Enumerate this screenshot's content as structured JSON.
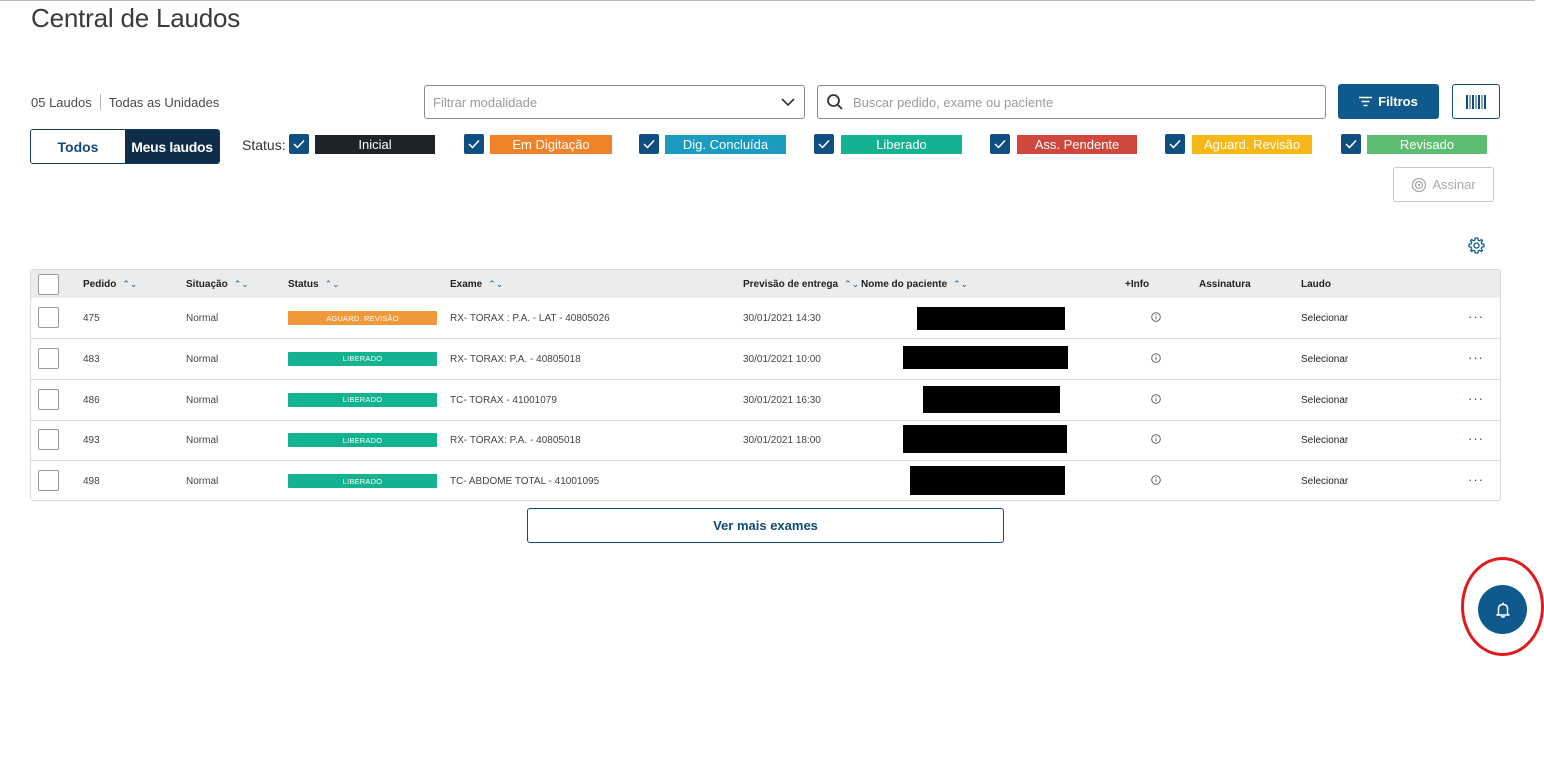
{
  "page": {
    "title": "Central de Laudos"
  },
  "summary": {
    "count": "05 Laudos",
    "unit": "Todas as Unidades"
  },
  "filters": {
    "modality_placeholder": "Filtrar modalidade",
    "search_placeholder": "Buscar pedido, exame ou paciente",
    "filtros_label": "Filtros"
  },
  "toggle": {
    "todos": "Todos",
    "meus": "Meus laudos"
  },
  "status_filter": {
    "label": "Status:",
    "items": [
      {
        "label": "Inicial",
        "color": "#1f2428"
      },
      {
        "label": "Em Digitação",
        "color": "#f0832a"
      },
      {
        "label": "Dig. Concluída",
        "color": "#1b9bc2"
      },
      {
        "label": "Liberado",
        "color": "#13b290"
      },
      {
        "label": "Ass. Pendente",
        "color": "#d0473d"
      },
      {
        "label": "Aguard. Revisão",
        "color": "#f8b718"
      },
      {
        "label": "Revisado",
        "color": "#5dbd72"
      }
    ]
  },
  "actions": {
    "assinar": "Assinar",
    "ver_mais": "Ver mais exames"
  },
  "table": {
    "headers": [
      "Pedido",
      "Situação",
      "Status",
      "Exame",
      "Previsão de entrega",
      "Nome do paciente",
      "+Info",
      "Assinatura",
      "Laudo"
    ],
    "rows": [
      {
        "pedido": "475",
        "situacao": "Normal",
        "status": "AGUARD. REVISÃO",
        "status_color": "#f0993a",
        "exame": "RX- TORAX : P.A. - LAT - 40805026",
        "previsao": "30/01/2021 14:30",
        "laudo": "Selecionar"
      },
      {
        "pedido": "483",
        "situacao": "Normal",
        "status": "LIBERADO",
        "status_color": "#13b290",
        "exame": "RX- TORAX: P.A. - 40805018",
        "previsao": "30/01/2021 10:00",
        "laudo": "Selecionar"
      },
      {
        "pedido": "486",
        "situacao": "Normal",
        "status": "LIBERADO",
        "status_color": "#13b290",
        "exame": "TC- TORAX - 41001079",
        "previsao": "30/01/2021 16:30",
        "laudo": "Selecionar"
      },
      {
        "pedido": "493",
        "situacao": "Normal",
        "status": "LIBERADO",
        "status_color": "#13b290",
        "exame": "RX- TORAX: P.A. - 40805018",
        "previsao": "30/01/2021 18:00",
        "laudo": "Selecionar"
      },
      {
        "pedido": "498",
        "situacao": "Normal",
        "status": "LIBERADO",
        "status_color": "#13b290",
        "exame": "TC- ABDOME TOTAL - 41001095",
        "previsao": "",
        "laudo": "Selecionar"
      }
    ]
  },
  "icons": [
    "search-icon",
    "chevron-down-icon",
    "filter-icon",
    "barcode-icon",
    "check-icon",
    "sign-icon",
    "gear-icon",
    "sort-icon",
    "info-icon",
    "more-icon",
    "bell-icon"
  ]
}
